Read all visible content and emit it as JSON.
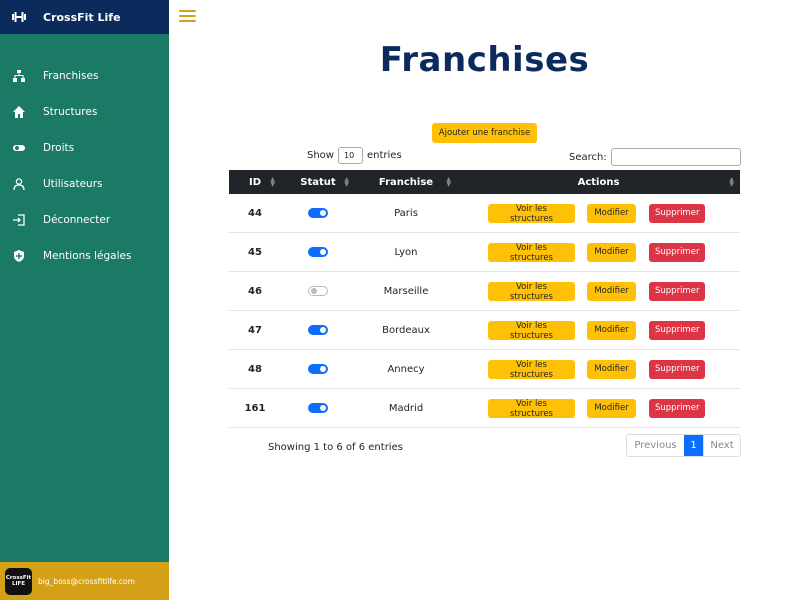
{
  "sidebar": {
    "brand": "CrossFit Life",
    "items": [
      {
        "label": "Franchises",
        "icon": "sitemap-icon"
      },
      {
        "label": "Structures",
        "icon": "house-icon"
      },
      {
        "label": "Droits",
        "icon": "toggle-icon"
      },
      {
        "label": "Utilisateurs",
        "icon": "user-icon"
      },
      {
        "label": "Déconnecter",
        "icon": "logout-icon"
      },
      {
        "label": "Mentions légales",
        "icon": "shield-icon"
      }
    ],
    "user": {
      "avatar_text_1": "CrossFit",
      "avatar_text_2": "LIFE",
      "email": "big_boss@crossfitlife.com"
    }
  },
  "page": {
    "title": "Franchises",
    "add_button": "Ajouter une franchise",
    "show_label": "Show",
    "entries_value": "10",
    "entries_label": "entries",
    "search_label": "Search:",
    "info": "Showing 1 to 6 of 6 entries"
  },
  "table": {
    "headers": {
      "id": "ID",
      "status": "Statut",
      "franchise": "Franchise",
      "actions": "Actions"
    },
    "rows": [
      {
        "id": "44",
        "active": true,
        "name": "Paris"
      },
      {
        "id": "45",
        "active": true,
        "name": "Lyon"
      },
      {
        "id": "46",
        "active": false,
        "name": "Marseille"
      },
      {
        "id": "47",
        "active": true,
        "name": "Bordeaux"
      },
      {
        "id": "48",
        "active": true,
        "name": "Annecy"
      },
      {
        "id": "161",
        "active": true,
        "name": "Madrid"
      }
    ],
    "actions": {
      "view": "Voir les structures",
      "edit": "Modifier",
      "delete": "Supprimer"
    }
  },
  "pagination": {
    "previous": "Previous",
    "current": "1",
    "next": "Next"
  },
  "colors": {
    "sidebar": "#1a7a66",
    "brand_bar": "#0d2a5c",
    "accent_yellow": "#ffc107",
    "danger": "#dc3545",
    "primary": "#0d6efd"
  }
}
